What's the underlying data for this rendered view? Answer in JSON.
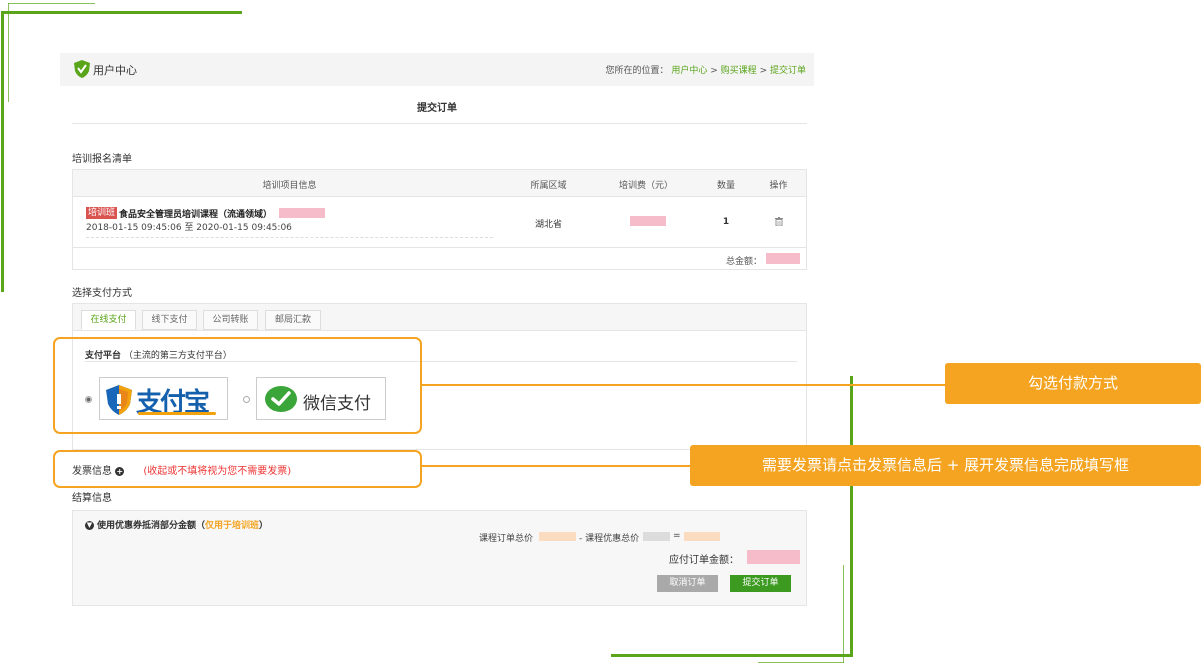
{
  "header": {
    "logo_text": "用户中心",
    "location_label": "您所在的位置：",
    "breadcrumb": [
      "用户中心",
      "购买课程",
      "提交订单"
    ],
    "breadcrumb_sep": ">"
  },
  "page_title": "提交订单",
  "enroll": {
    "title": "培训报名清单",
    "columns": [
      "培训项目信息",
      "所属区域",
      "培训费（元）",
      "数量",
      "操作"
    ],
    "row": {
      "tag": "培训班",
      "course_name": "食品安全管理员培训课程（流通领域）",
      "period": "2018-01-15 09:45:06 至 2020-01-15 09:45:06",
      "region": "湖北省",
      "quantity": "1",
      "delete_icon": "trash-icon"
    },
    "total_label": "总金额："
  },
  "payment": {
    "title": "选择支付方式",
    "tabs": [
      "在线支付",
      "线下支付",
      "公司转账",
      "邮局汇款"
    ],
    "active_tab": 0,
    "platform_label": "支付平台",
    "platform_note": "（主流的第三方支付平台）",
    "options": [
      {
        "name": "支付宝",
        "icon": "alipay-shield-icon",
        "selected": true
      },
      {
        "name": "微信支付",
        "icon": "wechat-pay-icon",
        "selected": false
      }
    ]
  },
  "invoice": {
    "label": "发票信息",
    "note": "(收起或不填将视为您不需要发票)"
  },
  "settlement": {
    "title": "结算信息",
    "coupon_label": "使用优惠券抵消部分金额（",
    "coupon_highlight": "仅用于培训班",
    "coupon_close": "）",
    "formula_total_label": "课程订单总价",
    "formula_minus": "- 课程优惠总价",
    "formula_eq": "=",
    "payable_label": "应付订单金额：",
    "cancel_label": "取消订单",
    "submit_label": "提交订单"
  },
  "annotations": {
    "payment_callout": "勾选付款方式",
    "invoice_callout": "需要发票请点击发票信息后 +  展开发票信息完成填写框"
  },
  "colors": {
    "brand_green": "#5aa51a",
    "annotation_orange": "#f4a421",
    "tag_red": "#d9534f",
    "submit_green": "#3c9a21"
  }
}
